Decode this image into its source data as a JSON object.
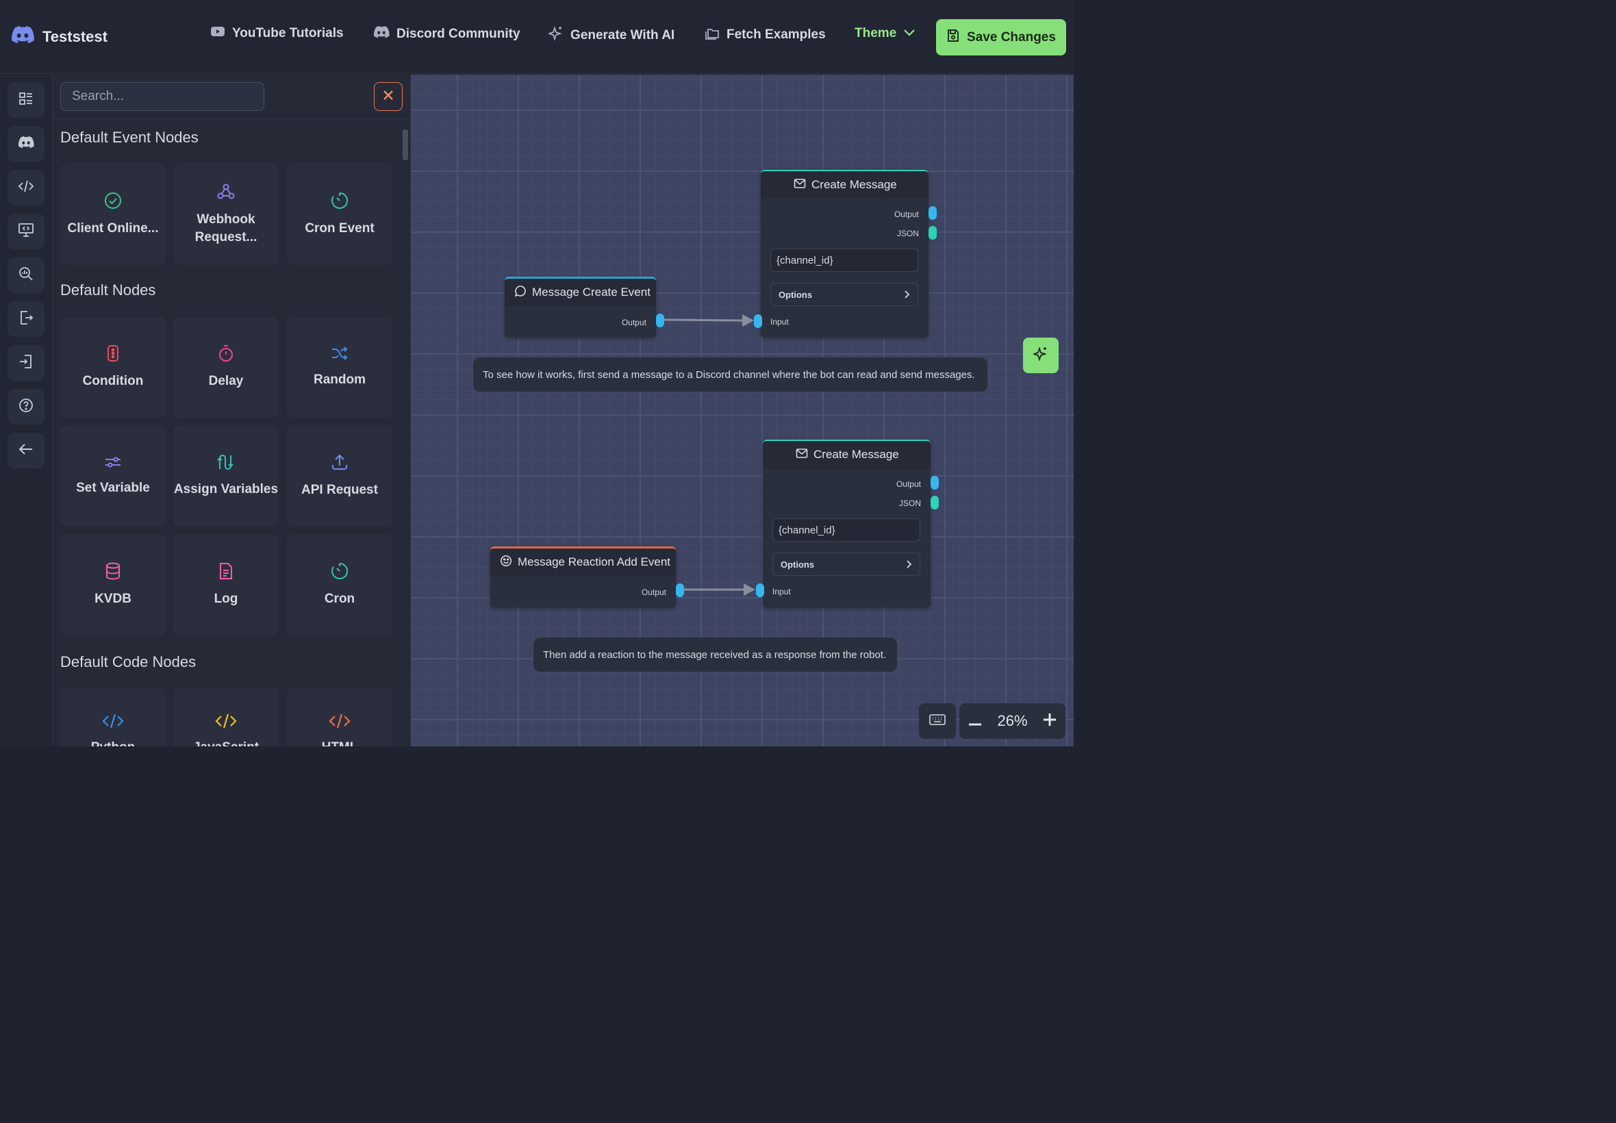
{
  "app": {
    "project_name": "Teststest"
  },
  "nav": {
    "youtube": "YouTube Tutorials",
    "discord": "Discord Community",
    "generate": "Generate With AI",
    "examples": "Fetch Examples",
    "theme": "Theme",
    "save": "Save Changes"
  },
  "search": {
    "placeholder": "Search..."
  },
  "sections": {
    "events": "Default Event Nodes",
    "default": "Default Nodes",
    "code": "Default Code Nodes"
  },
  "event_nodes": [
    "Client Online...",
    "Webhook Request...",
    "Cron Event"
  ],
  "default_nodes": [
    "Condition",
    "Delay",
    "Random",
    "Set Variable",
    "Assign Variables",
    "API Request",
    "KVDB",
    "Log",
    "Cron"
  ],
  "code_nodes": [
    "Python",
    "JavaScript",
    "HTML"
  ],
  "canvas": {
    "node1": {
      "title": "Message Create Event",
      "output": "Output"
    },
    "node2": {
      "title": "Create Message",
      "output": "Output",
      "json": "JSON",
      "field": "{channel_id}",
      "options": "Options",
      "input": "Input"
    },
    "note1": "To see how it works, first send a message to a Discord channel where the bot can read and send messages.",
    "node3": {
      "title": "Message Reaction Add Event",
      "output": "Output"
    },
    "node4": {
      "title": "Create Message",
      "output": "Output",
      "json": "JSON",
      "field": "{channel_id}",
      "options": "Options",
      "input": "Input"
    },
    "note2": "Then add a reaction to the message received as a response from the robot."
  },
  "zoom": {
    "level": "26%"
  },
  "colors": {
    "accent": "#86e07a",
    "canvas": "#3e4562",
    "port_blue": "#38b6f0",
    "port_teal": "#2ed3b7",
    "event_border": "#2aa8c9",
    "reaction_border": "#e0684a"
  },
  "icons": [
    "discord-logo-icon",
    "youtube-icon",
    "discord-icon",
    "sparkles-icon",
    "folders-icon",
    "chevron-down-icon",
    "save-icon",
    "layout-icon",
    "code-icon",
    "monitor-code-icon",
    "search-chart-icon",
    "export-icon",
    "import-icon",
    "help-icon",
    "arrow-left-icon",
    "close-icon",
    "check-circle-icon",
    "webhook-icon",
    "timer-icon",
    "condition-icon",
    "stopwatch-icon",
    "shuffle-icon",
    "sliders-icon",
    "swap-icon",
    "upload-icon",
    "database-icon",
    "file-icon",
    "message-icon",
    "mail-icon",
    "smile-icon",
    "keyboard-icon"
  ]
}
